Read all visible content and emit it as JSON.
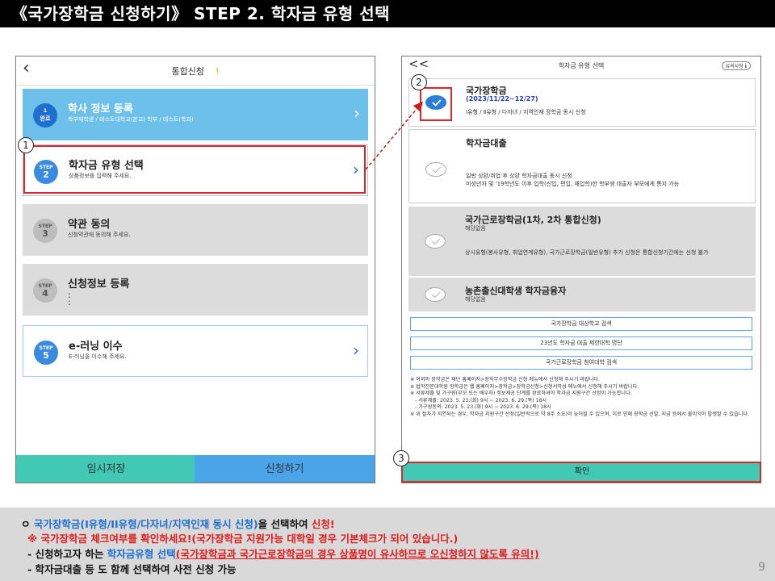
{
  "header": {
    "title": "《국가장학금 신청하기》 STEP 2. 학자금 유형 선택"
  },
  "left_phone": {
    "back_icon": "chevron-left-icon",
    "title": "통합신청",
    "title_mark": "!",
    "steps": [
      {
        "badge_top": "1",
        "badge_bottom": "완료",
        "title": "학사 정보 등록",
        "sub": "학부재학생 / 테스트대학교(본교) 학부 / 테스트(학과)"
      },
      {
        "badge_top": "STEP",
        "badge_bottom": "2",
        "title": "학자금 유형 선택",
        "sub": "상품정보를 입력해 주세요."
      },
      {
        "badge_top": "STEP",
        "badge_bottom": "3",
        "title": "약관 동의",
        "sub": "신청약관에 동의해 주세요."
      },
      {
        "badge_top": "STEP",
        "badge_bottom": "4",
        "title": "신청정보 등록",
        "sub": ":\n:"
      },
      {
        "badge_top": "STEP",
        "badge_bottom": "5",
        "title": "e-러닝 이수",
        "sub": "E-러닝을 이수해 주세요."
      }
    ],
    "temp_save_label": "임시저장",
    "apply_label": "신청하기"
  },
  "right_phone": {
    "back_label": "<<",
    "title": "학자금 유형 선택",
    "notice_label": "유의사항 ℹ",
    "options": [
      {
        "title": "국가장학금",
        "period": "(2023/11/22~12/27)",
        "desc": "Ⅰ유형 / Ⅱ유형 / 다자녀 / 지역인재 장학금 동시 신청",
        "checked": true
      },
      {
        "title": "학자금대출",
        "desc": "일반 상환/취업 후 상환 학자금대출 동시 신청\n미성년자 및 '19학년도 이후 입학(신입, 편입, 재입학)한 학부생 대출자 부모에게 통지 가능",
        "checked": false
      },
      {
        "title": "국가근로장학금(1차, 2차 통합신청)",
        "sub": "해당없음",
        "desc": "상시유형(봉사유형, 취업연계유형), 국가근로장학금(일반유형) 추가 신청은 통합신청기간에는 신청 불가",
        "checked": false
      },
      {
        "title": "농촌출신대학생 학자금융자",
        "sub": "해당없음",
        "checked": false
      }
    ],
    "links": [
      "국가장학금 대상학교 검색",
      "23년도 학자금 대출 제한대학 명단",
      "국가근로장학금 참여대학 검색"
    ],
    "notes": [
      "※ 이외의 장학금은 재단 홈페이지>장학무수장학금 신청 메뉴에서 신청해 주시기 바랍니다.",
      "※ 법학전문대학원 장학금은 웹 홈페이지>장학금>장학금신청>신청서작성 메뉴에서 신청해 주시기 바랍니다.",
      "※ 서류제출 및 가구원(부모 또는 배우자) 정보제공 단계를 완료하셔야 학자금 지원구간 산정이 가능합니다.",
      "- 서류제출: 2023. 5. 23.(화) 9시 ~ 2023. 6. 29.(목) 18시",
      "- 가구원동의: 2023. 5. 23.(화) 9시 ~ 2023. 6. 29.(목) 18시",
      "※ 위 절차가 지연되는 경우, 학자금 지원구간 산정(일반적으로 약 8주 소요)이 늦어질 수 있으며, 이로 인해 장학금 선발, 지급 등에서 불이익이 발생할 수 있습니다."
    ],
    "confirm_label": "확인"
  },
  "annotations": {
    "n1": "1",
    "n2": "2",
    "n3": "3"
  },
  "footer": {
    "l1_bullet": "ㅇ ",
    "l1_a": "국가장학금(I유형/II유형/다자녀/지역인재 동시 신청)",
    "l1_b": "을 선택하여 ",
    "l1_c": "신청!",
    "l2": "※ 국가장학금 체크여부를 확인하세요!(국가장학금 지원가능 대학일 경우 기본체크가 되어 있습니다.)",
    "l3_a": "- 신청하고자 하는 ",
    "l3_b": "학자금유형 선택",
    "l3_c": "(국가장학금과 국가근로장학금의 경우 상품명이 유사하므로 오신청하지 않도록 유의!)",
    "l4": "- 학자금대출 등 도 함께 선택하여 사전 신청 가능",
    "page": "9"
  },
  "colors": {
    "accent_red": "#e32424",
    "accent_blue": "#1a6fd0",
    "teal": "#42c9b6"
  }
}
